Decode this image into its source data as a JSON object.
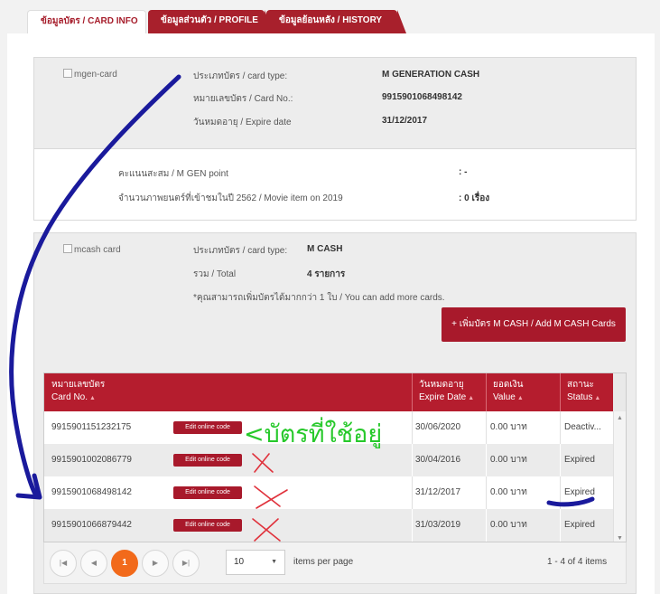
{
  "tabs": [
    {
      "label": "ข้อมูลบัตร / CARD INFO"
    },
    {
      "label": "ข้อมูลส่วนตัว / PROFILE"
    },
    {
      "label": "ข้อมูลย้อนหลัง / HISTORY"
    }
  ],
  "mgen": {
    "image_alt": "mgen-card",
    "card_type_label": "ประเภทบัตร / card type:",
    "card_type_value": "M GENERATION CASH",
    "card_no_label": "หมายเลขบัตร / Card No.:",
    "card_no_value": "9915901068498142",
    "expire_label": "วันหมดอายุ / Expire date",
    "expire_value": "31/12/2017"
  },
  "points": {
    "gen_point_label": "คะแนนสะสม / M GEN point",
    "gen_point_value": ": -",
    "movie_label": "จำนวนภาพยนตร์ที่เข้าชมในปี 2562 / Movie item on 2019",
    "movie_value": ": 0 เรื่อง"
  },
  "mcash": {
    "image_alt": "mcash card",
    "card_type_label": "ประเภทบัตร / card type:",
    "card_type_value": "M CASH",
    "total_label": "รวม / Total",
    "total_value": "4 รายการ",
    "note": "*คุณสามารถเพิ่มบัตรได้มากกว่า 1 ใบ / You can add more cards.",
    "add_button": "+ เพิ่มบัตร M CASH / Add M CASH Cards"
  },
  "grid": {
    "columns": [
      {
        "th": "หมายเลขบัตร",
        "en": "Card No."
      },
      {
        "th": "วันหมดอายุ",
        "en": "Expire Date"
      },
      {
        "th": "ยอดเงิน",
        "en": "Value"
      },
      {
        "th": "สถานะ",
        "en": "Status"
      }
    ],
    "edit_label": "Edit online code",
    "rows": [
      {
        "card_no": "9915901151232175",
        "expire": "30/06/2020",
        "value": "0.00 บาท",
        "status": "Deactiv..."
      },
      {
        "card_no": "9915901002086779",
        "expire": "30/04/2016",
        "value": "0.00 บาท",
        "status": "Expired"
      },
      {
        "card_no": "9915901068498142",
        "expire": "31/12/2017",
        "value": "0.00 บาท",
        "status": "Expired"
      },
      {
        "card_no": "9915901066879442",
        "expire": "31/03/2019",
        "value": "0.00 บาท",
        "status": "Expired"
      }
    ]
  },
  "pager": {
    "current_page": "1",
    "page_size": "10",
    "items_per_page": "items per page",
    "summary": "1 - 4 of 4 items"
  },
  "annotation": {
    "text": "<บัตรที่ใช้อยู่",
    "pen_blue": "#1a1a9c",
    "pen_red": "#e0323c",
    "pen_green": "#27c92b"
  }
}
